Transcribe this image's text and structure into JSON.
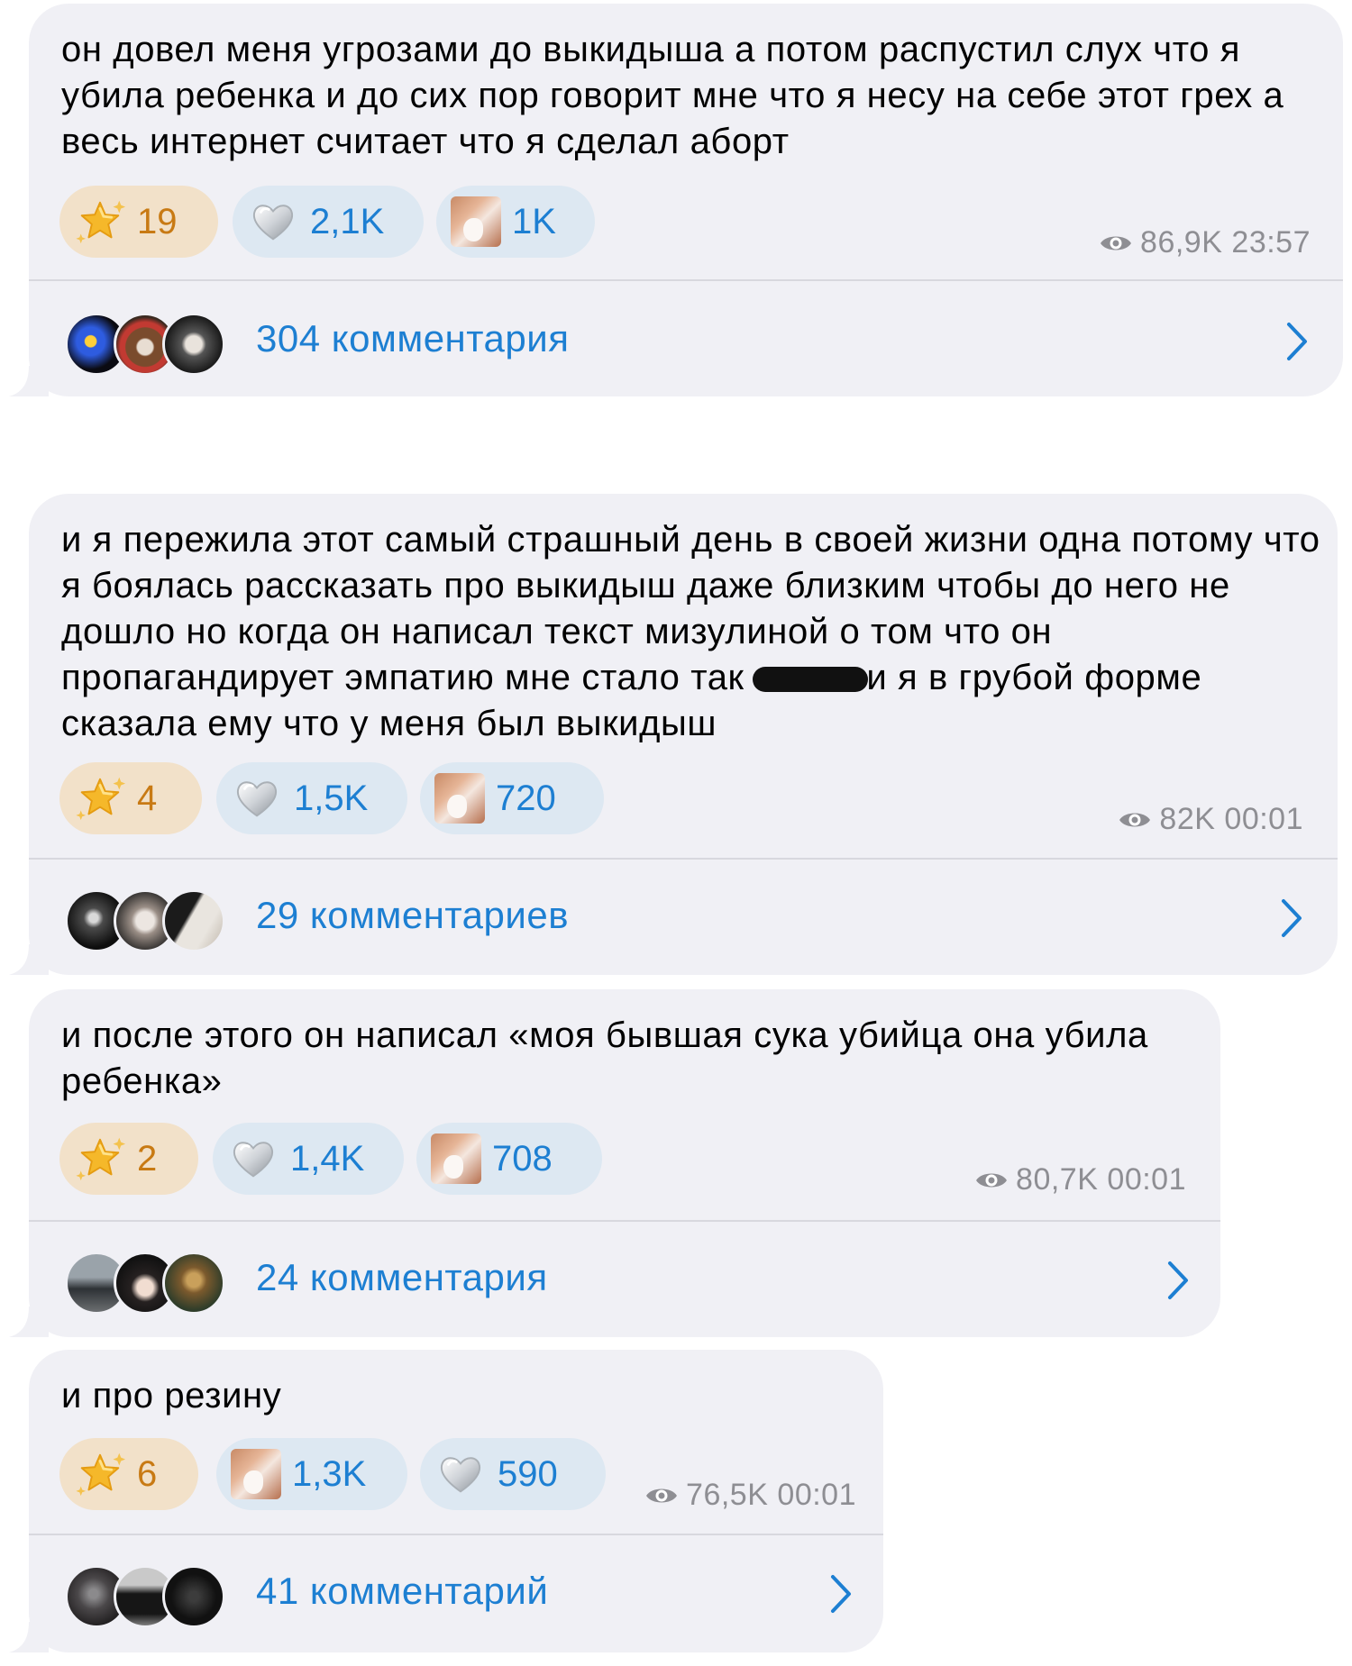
{
  "messages": [
    {
      "text": "он довел меня угрозами до выкидыша а потом распустил слух что я убила ребенка и до сих пор говорит мне что я несу на себе этот грех а весь интернет считает что я сделал аборт",
      "reactions": [
        {
          "type": "star",
          "count": "19"
        },
        {
          "type": "heart",
          "count": "2,1K"
        },
        {
          "type": "photo",
          "count": "1K"
        }
      ],
      "views": "86,9K",
      "time": "23:57",
      "comments": "304 комментария"
    },
    {
      "text_before": "и я пережила этот самый страшный день в своей жизни одна потому что я боялась рассказать про выкидыш даже близким чтобы до него не дошло но когда он написал текст мизулиной о том что он пропагандирует эмпатию мне стало так",
      "text_after": "и я в грубой форме сказала ему что у меня был выкидыш",
      "reactions": [
        {
          "type": "star",
          "count": "4"
        },
        {
          "type": "heart",
          "count": "1,5K"
        },
        {
          "type": "photo",
          "count": "720"
        }
      ],
      "views": "82K",
      "time": "00:01",
      "comments": "29 комментариев"
    },
    {
      "text": "и после этого он написал «моя бывшая сука убийца она убила ребенка»",
      "reactions": [
        {
          "type": "star",
          "count": "2"
        },
        {
          "type": "heart",
          "count": "1,4K"
        },
        {
          "type": "photo",
          "count": "708"
        }
      ],
      "views": "80,7K",
      "time": "00:01",
      "comments": "24 комментария"
    },
    {
      "text": "и про резину",
      "reactions": [
        {
          "type": "star",
          "count": "6"
        },
        {
          "type": "photo",
          "count": "1,3K"
        },
        {
          "type": "heart",
          "count": "590"
        }
      ],
      "views": "76,5K",
      "time": "00:01",
      "comments": "41 комментарий"
    }
  ],
  "icons": {
    "star": "star-icon",
    "heart": "silver-heart-icon",
    "photo": "photo-reaction-icon",
    "views": "eye-icon",
    "open_comments": "chevron-right-icon"
  },
  "colors": {
    "bubble": "#f0f0f5",
    "accent": "#1d7fd2",
    "star_bg": "#f2e1c9",
    "star_text": "#c87a14",
    "reaction_bg": "#dde8f2",
    "meta": "#8e8e93"
  }
}
